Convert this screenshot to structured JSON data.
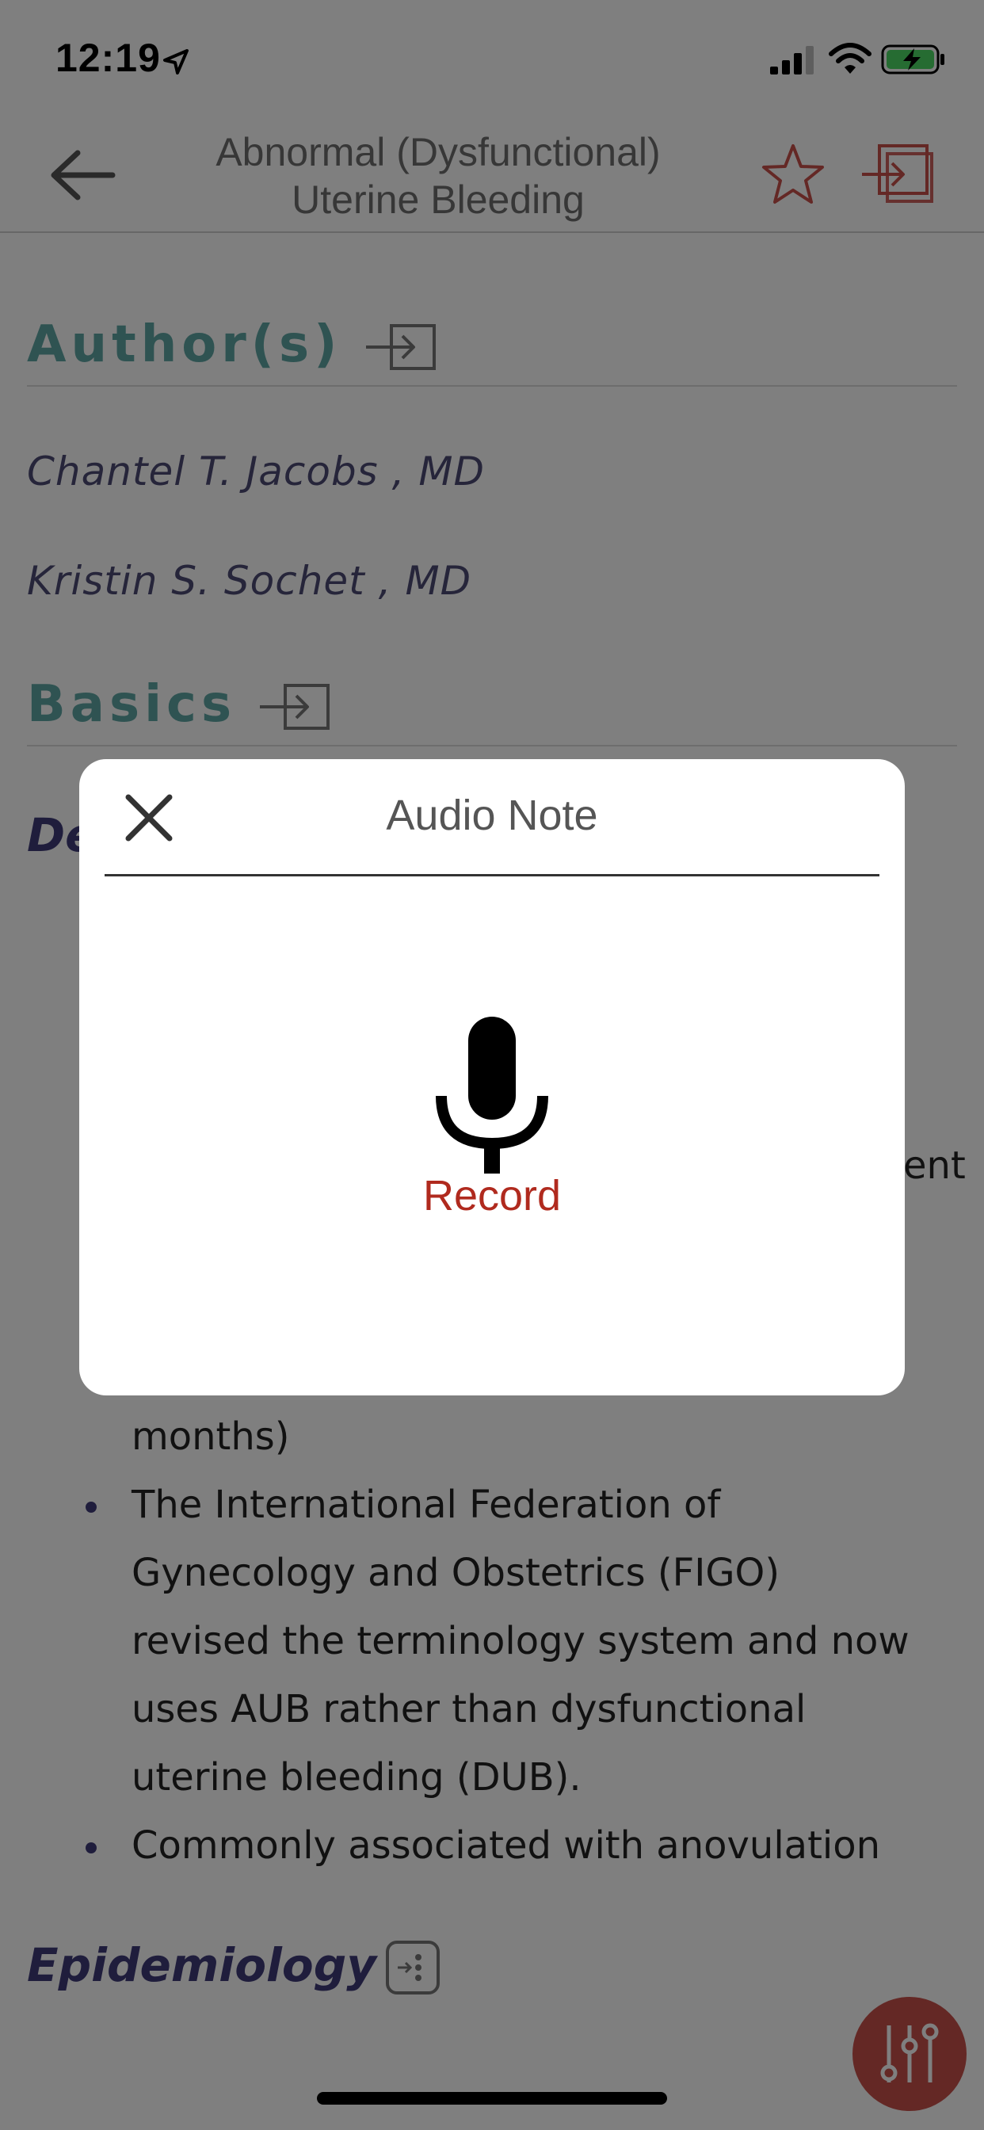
{
  "status_bar": {
    "time": "12:19",
    "icons": [
      "location-arrow-icon",
      "cellular-signal-icon",
      "wifi-icon",
      "battery-charging-icon"
    ]
  },
  "nav": {
    "title_line1": "Abnormal (Dysfunctional)",
    "title_line2": "Uterine Bleeding",
    "back_icon": "back-arrow-icon",
    "favorite_icon": "star-icon",
    "exit_icon": "exit-icon"
  },
  "content": {
    "authors_heading": "Author(s)",
    "authors": [
      "Chantel T. Jacobs , MD",
      "Kristin S. Sochet , MD"
    ],
    "basics_heading": "Basics",
    "description_heading_partial": "De",
    "partial_text": "ent",
    "bullets": [
      {
        "lines": [
          "months)"
        ],
        "has_bullet": false
      },
      {
        "lines": [
          "The International Federation of",
          "Gynecology and Obstetrics (FIGO)",
          "revised the terminology system and now",
          "uses AUB rather than dysfunctional",
          "uterine bleeding (DUB)."
        ],
        "has_bullet": true
      },
      {
        "lines": [
          "Commonly associated with anovulation"
        ],
        "has_bullet": true
      }
    ],
    "epidemiology_heading": "Epidemiology",
    "colors": {
      "section_heading": "#5fa6a4",
      "author_text": "#4c4a75",
      "sub_heading": "#3e3a78",
      "accent_red": "#c8504a"
    }
  },
  "modal": {
    "title": "Audio Note",
    "close_icon": "close-icon",
    "mic_icon": "microphone-icon",
    "record_label": "Record",
    "record_color": "#b02a1e"
  },
  "floating_button": {
    "icon": "sliders-icon"
  }
}
